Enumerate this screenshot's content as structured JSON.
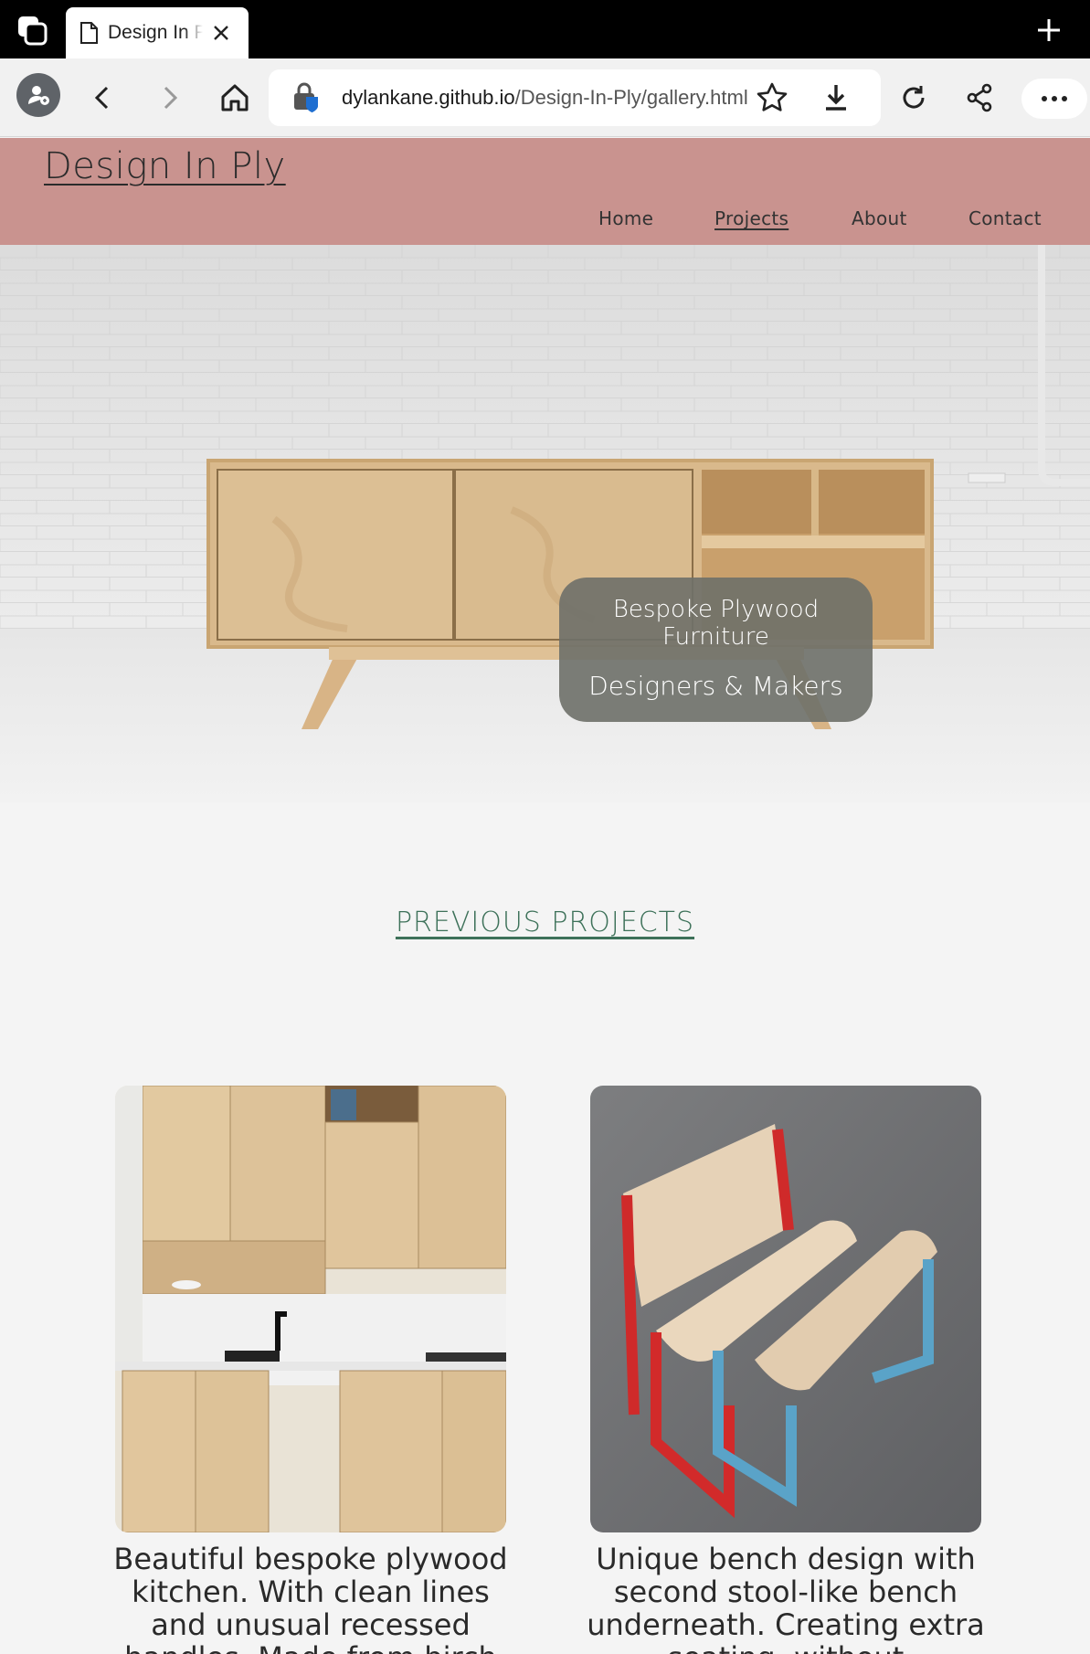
{
  "browser": {
    "tab_title": "Design In Ply",
    "url_host": "dylankane.github.io",
    "url_path": "/Design-In-Ply/gallery.html"
  },
  "site": {
    "logo": "Design In Ply",
    "nav": [
      {
        "label": "Home",
        "active": false
      },
      {
        "label": "Projects",
        "active": true
      },
      {
        "label": "About",
        "active": false
      },
      {
        "label": "Contact",
        "active": false
      }
    ]
  },
  "hero": {
    "line1": "Bespoke Plywood Furniture",
    "line2": "Designers & Makers"
  },
  "section": {
    "title": "PREVIOUS PROJECTS"
  },
  "projects": [
    {
      "image": "plywood-kitchen",
      "caption": "Beautiful bespoke plywood kitchen. With clean lines and unusual recessed handles. Made from birch"
    },
    {
      "image": "plywood-bench",
      "caption": "Unique bench design with second stool-like bench underneath. Creating extra seating, without"
    }
  ],
  "colors": {
    "header_bg": "#c9938f",
    "section_title": "#3d7159",
    "caption_bg": "#6e7069"
  }
}
